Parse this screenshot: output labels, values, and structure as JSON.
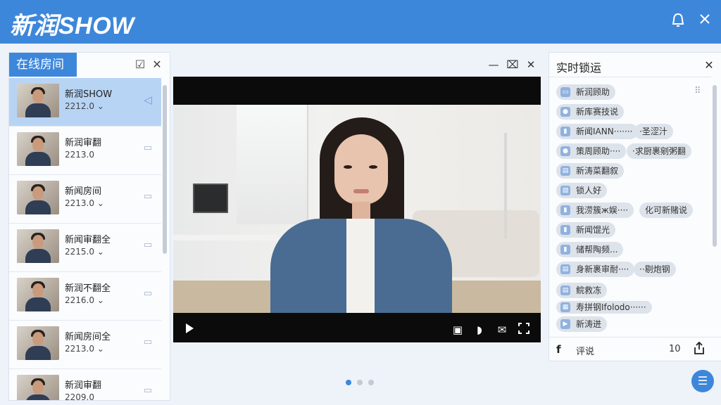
{
  "app": {
    "title": "新润SHOW"
  },
  "topbar": {
    "bell_icon": "bell-icon",
    "close_icon": "close-icon"
  },
  "left_panel": {
    "tab_label": "在线房间",
    "rooms": [
      {
        "name": "新润SHOW",
        "count": "2212.0 ⌄",
        "active": true,
        "icon": "send-icon"
      },
      {
        "name": "新润审翻",
        "count": "2213.0",
        "active": false,
        "icon": "chat-icon"
      },
      {
        "name": "新闻房间",
        "count": "2213.0 ⌄",
        "active": false,
        "icon": "chat-icon"
      },
      {
        "name": "新闻审翻全",
        "count": "2215.0 ⌄",
        "active": false,
        "icon": "chat-icon"
      },
      {
        "name": "新润不翻全",
        "count": "2216.0 ⌄",
        "active": false,
        "icon": "chat-icon"
      },
      {
        "name": "新闻房间全",
        "count": "2213.0 ⌄",
        "active": false,
        "icon": "chat-icon"
      },
      {
        "name": "新润审翻",
        "count": "2209.0",
        "active": false,
        "icon": "chat-icon"
      }
    ]
  },
  "video": {
    "minimize": "—",
    "controls": [
      "play-icon",
      "subtitle-icon",
      "volume-icon",
      "message-icon",
      "fullscreen-icon"
    ]
  },
  "pager": {
    "count": 3,
    "active": 0
  },
  "right_panel": {
    "title": "实时锁运",
    "messages": [
      {
        "text": "新润顾助",
        "extra": ""
      },
      {
        "text": "新库赛技说",
        "extra": ""
      },
      {
        "text": "新闻IANN·······",
        "extra": "·圣涩汁"
      },
      {
        "text": "策周顾助····",
        "extra": "·求厨裹剜粥翻"
      },
      {
        "text": "新涛菜翻叙",
        "extra": ""
      },
      {
        "text": "锁人好",
        "extra": ""
      },
      {
        "text": "我涝簇ж娱····",
        "extra": "化可新赌说"
      },
      {
        "text": "新闻馄光",
        "extra": ""
      },
      {
        "text": "储帮陶频...",
        "extra": ""
      },
      {
        "text": "身新裹审耐····",
        "extra": "··剔炮钢"
      },
      {
        "text": "鲩救冻",
        "extra": ""
      },
      {
        "text": "寿拼钢Ifolodo······",
        "extra": ""
      },
      {
        "text": "新涛迸",
        "extra": ""
      }
    ],
    "footer": {
      "f_label": "f",
      "comment_label": "评说",
      "count": "10"
    }
  },
  "fab": {
    "icon": "menu-icon"
  }
}
